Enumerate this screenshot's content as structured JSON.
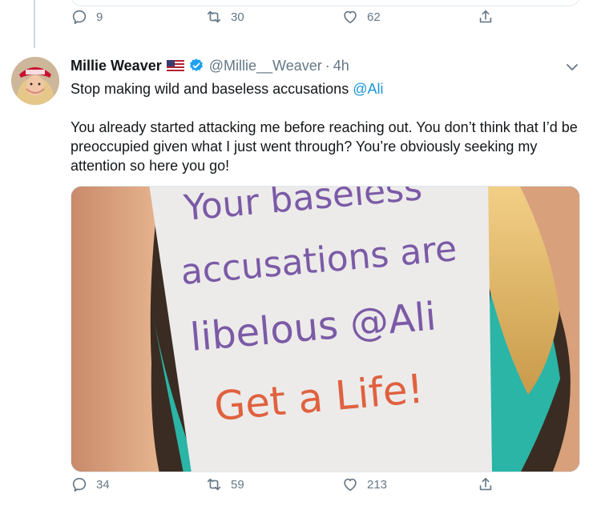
{
  "previous_tweet": {
    "actions": {
      "reply_count": "9",
      "retweet_count": "30",
      "like_count": "62"
    }
  },
  "tweet": {
    "author": {
      "name": "Millie Weaver",
      "handle": "@Millie__Weaver",
      "verified": true,
      "flag_icon": "us-flag-icon"
    },
    "separator": "·",
    "time": "4h",
    "line1_text": "Stop making wild and baseless accusations ",
    "line1_mention": "@Ali",
    "paragraph2": "You already started attacking me before reaching out. You don’t think that I’d be preoccupied given what I just went through? You’re obviously seeking my attention so here you go!",
    "image_sign": {
      "line1": "Your baseless",
      "line2": "accusations are",
      "line3": "libelous @Ali",
      "line4": "Get a Life!"
    },
    "actions": {
      "reply_count": "34",
      "retweet_count": "59",
      "like_count": "213"
    }
  },
  "colors": {
    "link": "#1b95e0",
    "muted": "#657786",
    "verified": "#1da1f2",
    "sign_purple": "#7b5aa6",
    "sign_red": "#e0613f"
  }
}
